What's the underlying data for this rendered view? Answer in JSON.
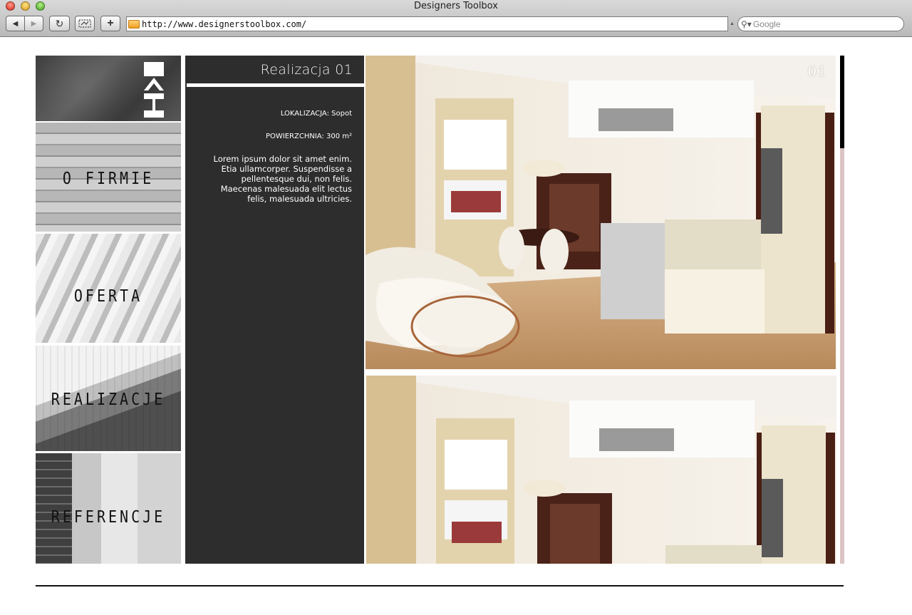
{
  "browser": {
    "window_title": "Designers Toolbox",
    "address": "http://www.designerstoolbox.com/",
    "search_placeholder": "Google",
    "back_label": "◀",
    "forward_label": "▶",
    "reload_label": "↻",
    "add_label": "+"
  },
  "nav": {
    "items": [
      {
        "label": "O FIRMIE"
      },
      {
        "label": "OFERTA"
      },
      {
        "label": "REALIZACJE"
      },
      {
        "label": "REFERENCJE"
      }
    ]
  },
  "project": {
    "title": "Realizacja 01",
    "location": "LOKALIZACJA: Sopot",
    "area": "POWIERZCHNIA: 300 m²",
    "description": "Lorem ipsum dolor sit amet enim. Etia ullamcorper. Suspendisse a pellentesque dui, non felis. Maecenas malesuada elit lectus felis, malesuada ultricies.",
    "photo_number": "01"
  },
  "colors": {
    "panel": "#2d2d2d",
    "scroll_track": "#dcc4c4",
    "scroll_thumb": "#000000"
  }
}
